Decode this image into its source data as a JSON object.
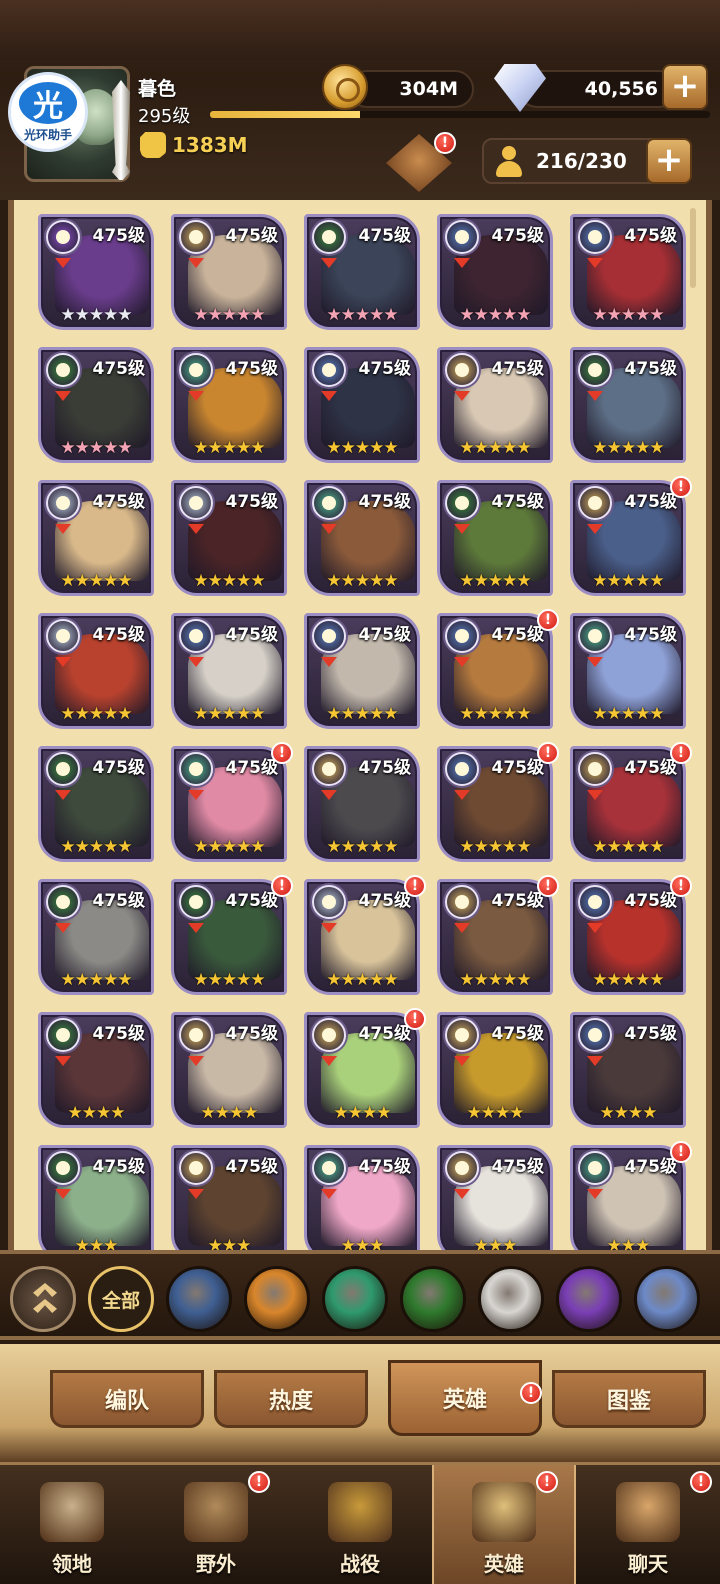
{
  "player": {
    "name": "暮色",
    "level": "295级",
    "power": "1383M",
    "xp_fraction": 0.3
  },
  "helper_badge": {
    "glyph": "光",
    "caption": "光环助手"
  },
  "resources": {
    "gold": "304M",
    "diamonds": "40,556",
    "roster": "216/230"
  },
  "colors": {
    "emblem": {
      "celestial": "#b9c7d8",
      "lightbearer": "#d7b25c",
      "wilder": "#4fb58f",
      "graveborn": "#3b8a3c",
      "mauler": "#d08a3a",
      "hypogean": "#8b4fc7",
      "dimensional": "#5b82c2"
    },
    "star_gold": "#f5c533",
    "star_pink": "#f3a3b4",
    "star_white": "#e9e9f2"
  },
  "heroes": [
    {
      "level": "475级",
      "stars": "★★★★★",
      "star_color": "white",
      "faction": "hypogean",
      "alert": false,
      "tone": "#6a3d8c"
    },
    {
      "level": "475级",
      "stars": "★★★★★",
      "star_color": "pink",
      "faction": "lightbearer",
      "alert": false,
      "tone": "#c9b39a"
    },
    {
      "level": "475级",
      "stars": "★★★★★",
      "star_color": "pink",
      "faction": "graveborn",
      "alert": false,
      "tone": "#3b4458"
    },
    {
      "level": "475级",
      "stars": "★★★★★",
      "star_color": "pink",
      "faction": "dimensional",
      "alert": false,
      "tone": "#3d2430"
    },
    {
      "level": "475级",
      "stars": "★★★★★",
      "star_color": "pink",
      "faction": "dimensional",
      "alert": false,
      "tone": "#a52f34"
    },
    {
      "level": "475级",
      "stars": "★★★★★",
      "star_color": "pink",
      "faction": "graveborn",
      "alert": false,
      "tone": "#3a3d36"
    },
    {
      "level": "475级",
      "stars": "★★★★★",
      "star_color": "gold",
      "faction": "wilder",
      "alert": false,
      "tone": "#c9862f"
    },
    {
      "level": "475级",
      "stars": "★★★★★",
      "star_color": "gold",
      "faction": "dimensional",
      "alert": false,
      "tone": "#2e3346"
    },
    {
      "level": "475级",
      "stars": "★★★★★",
      "star_color": "gold",
      "faction": "lightbearer",
      "alert": false,
      "tone": "#d9c9b4"
    },
    {
      "level": "475级",
      "stars": "★★★★★",
      "star_color": "gold",
      "faction": "graveborn",
      "alert": false,
      "tone": "#5d6f86"
    },
    {
      "level": "475级",
      "stars": "★★★★★",
      "star_color": "gold",
      "faction": "celestial",
      "alert": false,
      "tone": "#d9b98a"
    },
    {
      "level": "475级",
      "stars": "★★★★★",
      "star_color": "gold",
      "faction": "celestial",
      "alert": false,
      "tone": "#4a2426"
    },
    {
      "level": "475级",
      "stars": "★★★★★",
      "star_color": "gold",
      "faction": "wilder",
      "alert": false,
      "tone": "#8a5a3a"
    },
    {
      "level": "475级",
      "stars": "★★★★★",
      "star_color": "gold",
      "faction": "graveborn",
      "alert": false,
      "tone": "#5e7a3a"
    },
    {
      "level": "475级",
      "stars": "★★★★★",
      "star_color": "gold",
      "faction": "lightbearer",
      "alert": true,
      "tone": "#4a5f8a"
    },
    {
      "level": "475级",
      "stars": "★★★★★",
      "star_color": "gold",
      "faction": "celestial",
      "alert": false,
      "tone": "#b8422e"
    },
    {
      "level": "475级",
      "stars": "★★★★★",
      "star_color": "gold",
      "faction": "dimensional",
      "alert": false,
      "tone": "#d6d0c8"
    },
    {
      "level": "475级",
      "stars": "★★★★★",
      "star_color": "gold",
      "faction": "dimensional",
      "alert": false,
      "tone": "#c2b8ac"
    },
    {
      "level": "475级",
      "stars": "★★★★★",
      "star_color": "gold",
      "faction": "dimensional",
      "alert": true,
      "tone": "#b57a3e"
    },
    {
      "level": "475级",
      "stars": "★★★★★",
      "star_color": "gold",
      "faction": "wilder",
      "alert": false,
      "tone": "#8fa2d8"
    },
    {
      "level": "475级",
      "stars": "★★★★★",
      "star_color": "gold",
      "faction": "graveborn",
      "alert": false,
      "tone": "#3e4a3c"
    },
    {
      "level": "475级",
      "stars": "★★★★★",
      "star_color": "gold",
      "faction": "wilder",
      "alert": true,
      "tone": "#e08aa5"
    },
    {
      "level": "475级",
      "stars": "★★★★★",
      "star_color": "gold",
      "faction": "lightbearer",
      "alert": false,
      "tone": "#4d4a4e"
    },
    {
      "level": "475级",
      "stars": "★★★★★",
      "star_color": "gold",
      "faction": "dimensional",
      "alert": true,
      "tone": "#6e4a32"
    },
    {
      "level": "475级",
      "stars": "★★★★★",
      "star_color": "gold",
      "faction": "lightbearer",
      "alert": true,
      "tone": "#a8323a"
    },
    {
      "level": "475级",
      "stars": "★★★★★",
      "star_color": "gold",
      "faction": "graveborn",
      "alert": false,
      "tone": "#8c8a86"
    },
    {
      "level": "475级",
      "stars": "★★★★★",
      "star_color": "gold",
      "faction": "graveborn",
      "alert": true,
      "tone": "#3a5a3c"
    },
    {
      "level": "475级",
      "stars": "★★★★★",
      "star_color": "gold",
      "faction": "celestial",
      "alert": true,
      "tone": "#d8c39a"
    },
    {
      "level": "475级",
      "stars": "★★★★★",
      "star_color": "gold",
      "faction": "lightbearer",
      "alert": true,
      "tone": "#7a5a40"
    },
    {
      "level": "475级",
      "stars": "★★★★★",
      "star_color": "gold",
      "faction": "dimensional",
      "alert": true,
      "tone": "#b8322c"
    },
    {
      "level": "475级",
      "stars": "★★★★",
      "star_color": "gold",
      "faction": "graveborn",
      "alert": false,
      "tone": "#5a3638"
    },
    {
      "level": "475级",
      "stars": "★★★★",
      "star_color": "gold",
      "faction": "lightbearer",
      "alert": false,
      "tone": "#c8b8a6"
    },
    {
      "level": "475级",
      "stars": "★★★★",
      "star_color": "gold",
      "faction": "lightbearer",
      "alert": true,
      "tone": "#a9d07a"
    },
    {
      "level": "475级",
      "stars": "★★★★",
      "star_color": "gold",
      "faction": "lightbearer",
      "alert": false,
      "tone": "#c79a2c"
    },
    {
      "level": "475级",
      "stars": "★★★★",
      "star_color": "gold",
      "faction": "dimensional",
      "alert": false,
      "tone": "#4a3a3a"
    },
    {
      "level": "475级",
      "stars": "★★★",
      "star_color": "gold",
      "faction": "graveborn",
      "alert": false,
      "tone": "#8cb08a"
    },
    {
      "level": "475级",
      "stars": "★★★",
      "star_color": "gold",
      "faction": "lightbearer",
      "alert": false,
      "tone": "#5e4430"
    },
    {
      "level": "475级",
      "stars": "★★★",
      "star_color": "gold",
      "faction": "wilder",
      "alert": false,
      "tone": "#f0a8c8"
    },
    {
      "level": "475级",
      "stars": "★★★",
      "star_color": "gold",
      "faction": "lightbearer",
      "alert": false,
      "tone": "#e6e2dc"
    },
    {
      "level": "475级",
      "stars": "★★★",
      "star_color": "gold",
      "faction": "wilder",
      "alert": true,
      "tone": "#cfc3b4"
    }
  ],
  "filters": [
    {
      "id": "collapse",
      "label": ""
    },
    {
      "id": "all",
      "label": "全部"
    },
    {
      "id": "celestial-dim",
      "label": ""
    },
    {
      "id": "mauler",
      "label": ""
    },
    {
      "id": "wilder",
      "label": ""
    },
    {
      "id": "graveborn",
      "label": ""
    },
    {
      "id": "celestial",
      "label": ""
    },
    {
      "id": "hypogean",
      "label": ""
    },
    {
      "id": "dimensional",
      "label": ""
    }
  ],
  "subtabs": [
    {
      "label": "编队",
      "active": false
    },
    {
      "label": "热度",
      "active": false
    },
    {
      "label": "英雄",
      "active": true,
      "alert": true
    },
    {
      "label": "图鉴",
      "active": false
    }
  ],
  "nav": [
    {
      "label": "领地",
      "icon": "castle-icon",
      "active": false,
      "alert": false
    },
    {
      "label": "野外",
      "icon": "map-scroll-icon",
      "active": false,
      "alert": true
    },
    {
      "label": "战役",
      "icon": "campaign-sword-icon",
      "active": false,
      "alert": false
    },
    {
      "label": "英雄",
      "icon": "hero-helmet-icon",
      "active": true,
      "alert": true
    },
    {
      "label": "聊天",
      "icon": "chat-bubble-icon",
      "active": false,
      "alert": true
    }
  ]
}
